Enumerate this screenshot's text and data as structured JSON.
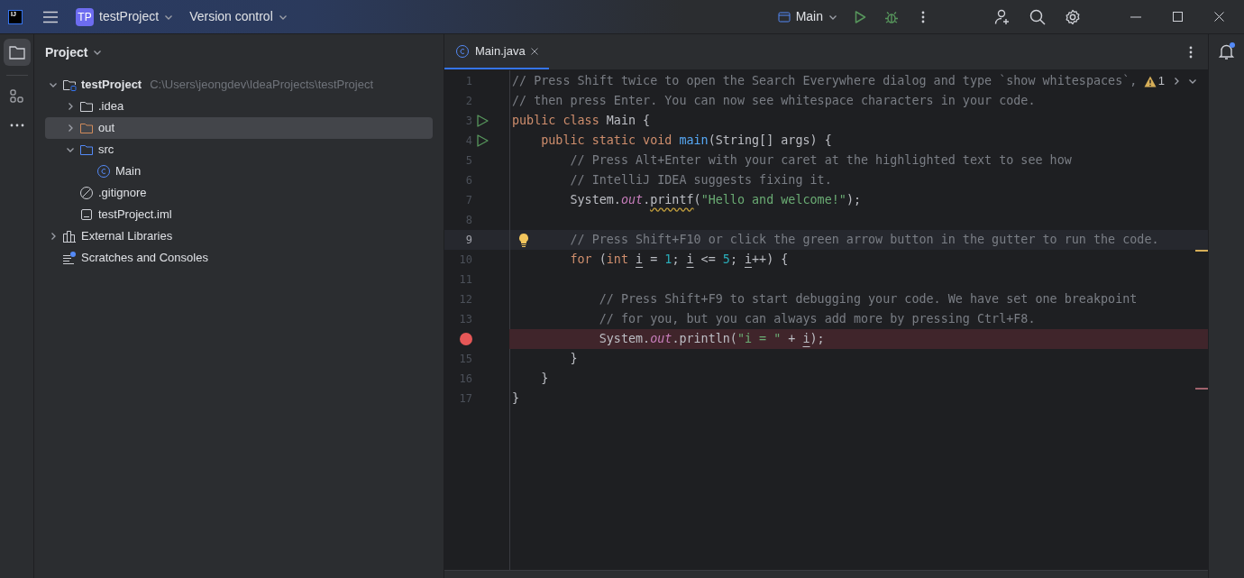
{
  "title_bar": {
    "logo": "IJ",
    "project_badge": "TP",
    "project": "testProject",
    "vcs": "Version control",
    "run_config": "Main"
  },
  "project_panel": {
    "title": "Project",
    "tree": [
      {
        "label": "testProject",
        "path": "C:\\Users\\jeongdev\\IdeaProjects\\testProject",
        "kind": "project",
        "expanded": true,
        "selected": false,
        "children": [
          {
            "label": ".idea",
            "kind": "folder",
            "expanded": false,
            "selected": false
          },
          {
            "label": "out",
            "kind": "excluded-folder",
            "expanded": false,
            "selected": true
          },
          {
            "label": "src",
            "kind": "source-folder",
            "expanded": true,
            "selected": false,
            "children": [
              {
                "label": "Main",
                "kind": "class",
                "selected": false
              }
            ]
          },
          {
            "label": ".gitignore",
            "kind": "ignore",
            "selected": false
          },
          {
            "label": "testProject.iml",
            "kind": "file",
            "selected": false
          }
        ]
      },
      {
        "label": "External Libraries",
        "kind": "libraries",
        "expanded": false,
        "selected": false
      },
      {
        "label": "Scratches and Consoles",
        "kind": "scratches",
        "selected": false
      }
    ]
  },
  "editor": {
    "tabs": [
      {
        "label": "Main.java",
        "selected": true
      }
    ],
    "warnings": "1",
    "lines": [
      {
        "number": "1",
        "current": false,
        "runnable": false,
        "breakpoint": false,
        "bulb": false,
        "tokens": [
          {
            "text": "// Press Shift twice to open the Search Everywhere dialog and type `show whitespaces`,",
            "kind": "comment"
          }
        ]
      },
      {
        "number": "2",
        "current": false,
        "runnable": false,
        "breakpoint": false,
        "bulb": false,
        "tokens": [
          {
            "text": "// then press Enter. You can now see whitespace characters in your code.",
            "kind": "comment"
          }
        ]
      },
      {
        "number": "3",
        "current": false,
        "runnable": true,
        "breakpoint": false,
        "bulb": false,
        "tokens": [
          {
            "text": "public class ",
            "kind": "keyword"
          },
          {
            "text": "Main {",
            "kind": "plain"
          }
        ]
      },
      {
        "number": "4",
        "current": false,
        "runnable": true,
        "breakpoint": false,
        "bulb": false,
        "tokens": [
          {
            "text": "    public static void ",
            "kind": "keyword"
          },
          {
            "text": "main",
            "kind": "method"
          },
          {
            "text": "(String[] args) {",
            "kind": "plain"
          }
        ]
      },
      {
        "number": "5",
        "current": false,
        "runnable": false,
        "breakpoint": false,
        "bulb": false,
        "tokens": [
          {
            "text": "        // Press Alt+Enter with your caret at the highlighted text to see how",
            "kind": "comment"
          }
        ]
      },
      {
        "number": "6",
        "current": false,
        "runnable": false,
        "breakpoint": false,
        "bulb": false,
        "tokens": [
          {
            "text": "        // IntelliJ IDEA suggests fixing it.",
            "kind": "comment"
          }
        ]
      },
      {
        "number": "7",
        "current": false,
        "runnable": false,
        "breakpoint": false,
        "bulb": false,
        "tokens": [
          {
            "text": "        System.",
            "kind": "plain"
          },
          {
            "text": "out",
            "kind": "field"
          },
          {
            "text": ".",
            "kind": "plain"
          },
          {
            "text": "printf",
            "kind": "warning"
          },
          {
            "text": "(",
            "kind": "plain"
          },
          {
            "text": "\"Hello and welcome!\"",
            "kind": "string"
          },
          {
            "text": ");",
            "kind": "plain"
          }
        ]
      },
      {
        "number": "8",
        "current": false,
        "runnable": false,
        "breakpoint": false,
        "bulb": false
      },
      {
        "number": "9",
        "current": true,
        "runnable": false,
        "breakpoint": false,
        "bulb": true,
        "tokens": [
          {
            "text": "        // Press Shift+F10 or click the green arrow button in the gutter to run the code.",
            "kind": "comment"
          }
        ]
      },
      {
        "number": "10",
        "current": false,
        "runnable": false,
        "breakpoint": false,
        "bulb": false,
        "tokens": [
          {
            "text": "        for ",
            "kind": "keyword"
          },
          {
            "text": "(",
            "kind": "plain"
          },
          {
            "text": "int ",
            "kind": "keyword"
          },
          {
            "text": "i",
            "kind": "variable"
          },
          {
            "text": " = ",
            "kind": "plain"
          },
          {
            "text": "1",
            "kind": "number"
          },
          {
            "text": "; ",
            "kind": "plain"
          },
          {
            "text": "i",
            "kind": "variable"
          },
          {
            "text": " <= ",
            "kind": "plain"
          },
          {
            "text": "5",
            "kind": "number"
          },
          {
            "text": "; ",
            "kind": "plain"
          },
          {
            "text": "i",
            "kind": "variable"
          },
          {
            "text": "++) {",
            "kind": "plain"
          }
        ]
      },
      {
        "number": "11",
        "current": false,
        "runnable": false,
        "breakpoint": false,
        "bulb": false
      },
      {
        "number": "12",
        "current": false,
        "runnable": false,
        "breakpoint": false,
        "bulb": false,
        "tokens": [
          {
            "text": "            // Press Shift+F9 to start debugging your code. We have set one breakpoint",
            "kind": "comment"
          }
        ]
      },
      {
        "number": "13",
        "current": false,
        "runnable": false,
        "breakpoint": false,
        "bulb": false,
        "tokens": [
          {
            "text": "            // for you, but you can always add more by pressing Ctrl+F8.",
            "kind": "comment"
          }
        ]
      },
      {
        "current": false,
        "runnable": false,
        "breakpoint": true,
        "bulb": false,
        "tokens": [
          {
            "text": "            System.",
            "kind": "plain"
          },
          {
            "text": "out",
            "kind": "field"
          },
          {
            "text": ".println(",
            "kind": "plain"
          },
          {
            "text": "\"i = \"",
            "kind": "string"
          },
          {
            "text": " + ",
            "kind": "plain"
          },
          {
            "text": "i",
            "kind": "variable"
          },
          {
            "text": ");",
            "kind": "plain"
          }
        ]
      },
      {
        "number": "15",
        "current": false,
        "runnable": false,
        "breakpoint": false,
        "bulb": false,
        "tokens": [
          {
            "text": "        }",
            "kind": "plain"
          }
        ]
      },
      {
        "number": "16",
        "current": false,
        "runnable": false,
        "breakpoint": false,
        "bulb": false,
        "tokens": [
          {
            "text": "    }",
            "kind": "plain"
          }
        ]
      },
      {
        "number": "17",
        "current": false,
        "runnable": false,
        "breakpoint": false,
        "bulb": false,
        "tokens": [
          {
            "text": "}",
            "kind": "plain"
          }
        ]
      }
    ]
  }
}
